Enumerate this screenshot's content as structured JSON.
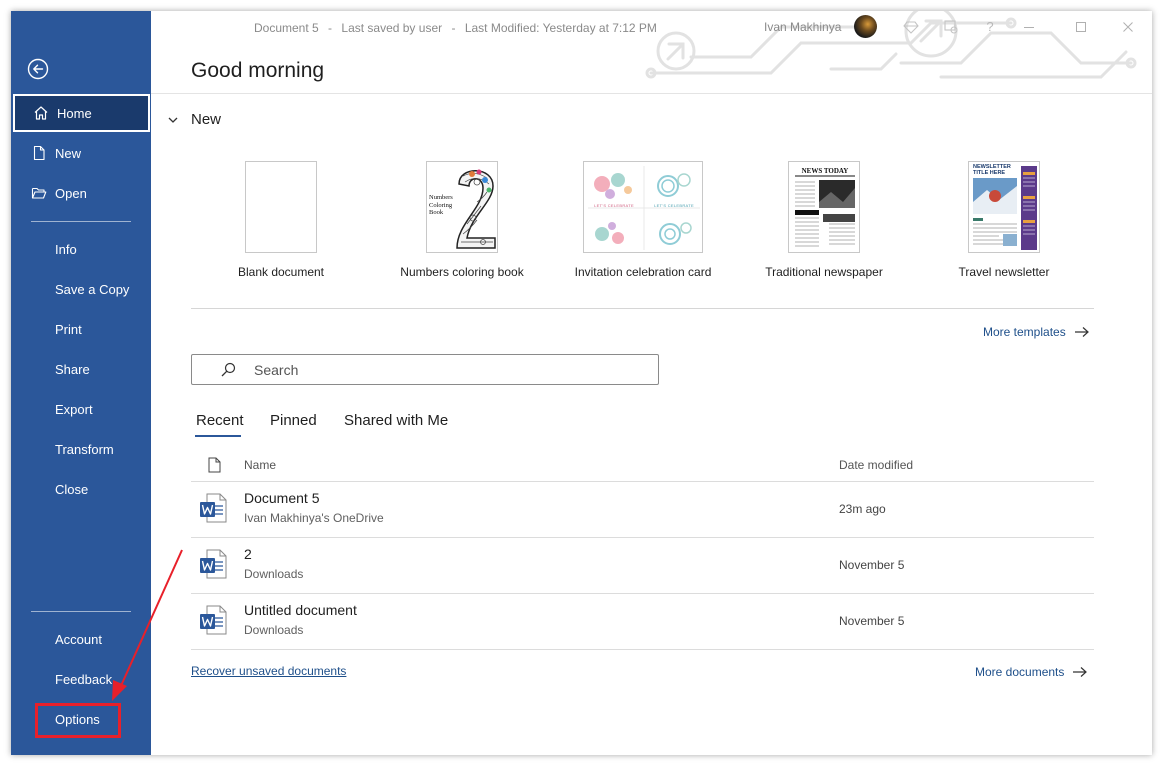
{
  "titlebar": {
    "doc_name": "Document 5",
    "sep": "-",
    "saved_status": "Last saved by user",
    "modified": "Last Modified: Yesterday at 7:12 PM",
    "user_name": "Ivan Makhinya",
    "help": "?"
  },
  "sidebar": {
    "items": [
      {
        "label": "Home"
      },
      {
        "label": "New"
      },
      {
        "label": "Open"
      },
      {
        "label": "Info"
      },
      {
        "label": "Save a Copy"
      },
      {
        "label": "Print"
      },
      {
        "label": "Share"
      },
      {
        "label": "Export"
      },
      {
        "label": "Transform"
      },
      {
        "label": "Close"
      },
      {
        "label": "Account"
      },
      {
        "label": "Feedback"
      },
      {
        "label": "Options"
      }
    ]
  },
  "main": {
    "greeting": "Good morning",
    "new_section": "New",
    "templates": [
      {
        "name": "Blank document"
      },
      {
        "name": "Numbers coloring book",
        "thumb_text": "Numbers Coloring Book",
        "thumb_number": "2"
      },
      {
        "name": "Invitation celebration card",
        "thumb_text": "LET'S CELEBRATE"
      },
      {
        "name": "Traditional newspaper",
        "thumb_text": "NEWS TODAY"
      },
      {
        "name": "Travel newsletter",
        "thumb_text": "NEWSLETTER TITLE HERE"
      }
    ],
    "more_templates": "More templates",
    "search_placeholder": "Search",
    "tabs": [
      {
        "label": "Recent"
      },
      {
        "label": "Pinned"
      },
      {
        "label": "Shared with Me"
      }
    ],
    "columns": {
      "name": "Name",
      "date": "Date modified"
    },
    "files": [
      {
        "name": "Document 5",
        "location": "Ivan Makhinya's OneDrive",
        "date": "23m ago"
      },
      {
        "name": "2",
        "location": "Downloads",
        "date": "November 5"
      },
      {
        "name": "Untitled document",
        "location": "Downloads",
        "date": "November 5"
      }
    ],
    "recover_link": "Recover unsaved documents",
    "more_documents": "More documents"
  },
  "colors": {
    "sidebar": "#2b579a",
    "sidebar_active": "#1a3a6c",
    "link": "#1e4f8a",
    "highlight": "#e8202a"
  }
}
